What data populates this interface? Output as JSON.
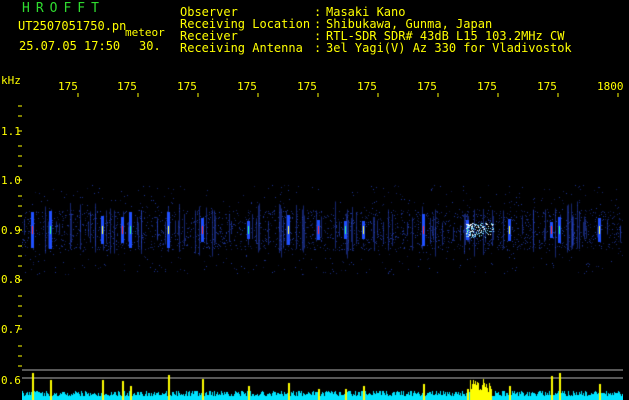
{
  "header": {
    "brand": "HROFFT",
    "file_name": "UT2507051750.pn",
    "meteor_label": "meteor",
    "date_time": "25.07.05 17:50",
    "duration": "30."
  },
  "info": [
    {
      "label": "Observer",
      "colon": ":",
      "value": "Masaki Kano"
    },
    {
      "label": "Receiving Location",
      "colon": ":",
      "value": "Shibukawa, Gunma, Japan"
    },
    {
      "label": "Receiver",
      "colon": ":",
      "value": "RTL-SDR SDR# 43dB L15 103.2MHz CW"
    },
    {
      "label": "Receiving Antenna",
      "colon": ":",
      "value": "3el Yagi(V) Az 330 for Vladivostok"
    }
  ],
  "axes": {
    "y_unit": "kHz",
    "y_ticks": [
      "1.1",
      "1.0",
      "0.9",
      "0.8",
      "0.7",
      "0.6"
    ],
    "x_ticks": [
      "175",
      "175",
      "175",
      "175",
      "175",
      "175",
      "175",
      "175",
      "175",
      "1800"
    ]
  },
  "colors": {
    "text": "#ffff00",
    "brand": "#2fdc2f",
    "background": "#000000",
    "signal_low": "#1a2a9a",
    "signal_high": "#ff3030",
    "level_trace": "#00e5ff",
    "level_spike": "#ffff00"
  },
  "level": {
    "echo_spike_minutes": [
      0.5,
      1.4,
      4.0,
      5.0,
      5.4,
      7.3,
      9.0,
      11.3,
      13.3,
      14.8,
      16.1,
      17.0,
      20.0,
      22.2,
      24.3,
      26.4,
      26.8,
      28.8
    ]
  }
}
